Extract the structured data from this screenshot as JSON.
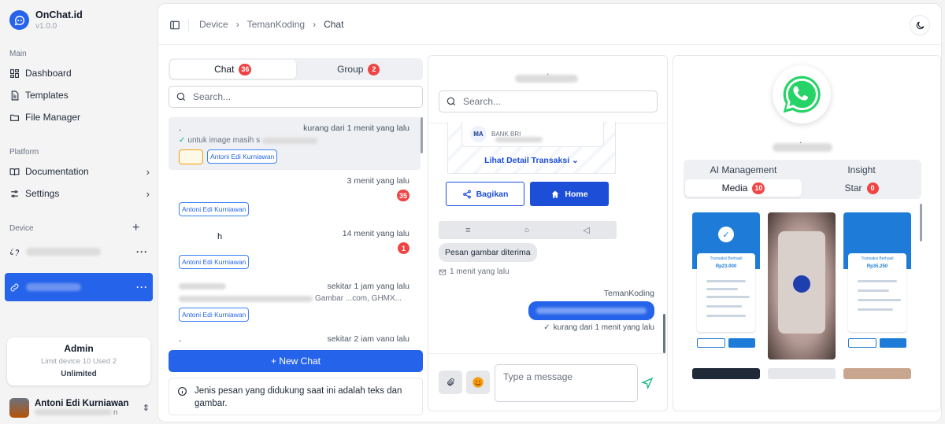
{
  "app": {
    "name": "OnChat.id",
    "version": "v1.0.0"
  },
  "sidebar": {
    "section_main": "Main",
    "main_items": [
      {
        "label": "Dashboard",
        "icon": "dashboard-icon"
      },
      {
        "label": "Templates",
        "icon": "file-text-icon"
      },
      {
        "label": "File Manager",
        "icon": "folder-icon"
      }
    ],
    "section_platform": "Platform",
    "platform_items": [
      {
        "label": "Documentation",
        "icon": "book-icon"
      },
      {
        "label": "Settings",
        "icon": "sliders-icon"
      }
    ],
    "section_device": "Device",
    "admin_card": {
      "title": "Admin",
      "limit": "Limit device 10 Used 2",
      "plan": "Unlimited"
    },
    "user": {
      "name": "Antoni Edi Kurniawan",
      "suffix": "n"
    }
  },
  "topbar": {
    "breadcrumb": [
      "Device",
      "TemanKoding",
      "Chat"
    ]
  },
  "chat_panel": {
    "tabs": [
      {
        "label": "Chat",
        "count": "36"
      },
      {
        "label": "Group",
        "count": "2"
      }
    ],
    "search_placeholder": "Search...",
    "items": [
      {
        "name": ".",
        "time": "kurang dari 1 menit yang lalu",
        "preview": "untuk image masih s",
        "tag": "Antoni Edi Kurniawan",
        "badge": ""
      },
      {
        "name": "",
        "time": "3 menit yang lalu",
        "preview": "",
        "tag": "Antoni Edi Kurniawan",
        "badge": "35"
      },
      {
        "name": "h",
        "time": "14 menit yang lalu",
        "preview": "",
        "tag": "Antoni Edi Kurniawan",
        "badge": "1"
      },
      {
        "name": "",
        "time": "sekitar 1 jam yang lalu",
        "preview": "Gambar ...com, GHMX...",
        "tag": "Antoni Edi Kurniawan",
        "badge": ""
      },
      {
        "name": ".",
        "time": "sekitar 2 jam yang lalu",
        "preview": "",
        "tag": "",
        "badge": ""
      }
    ],
    "new_chat_label": "+ New Chat",
    "info_text": "Jenis pesan yang didukung saat ini adalah teks dan gambar."
  },
  "conversation": {
    "contact_name": ".",
    "search_placeholder": "Search...",
    "receipt": {
      "bank_initials": "MA",
      "bank_name": "BANK BRI",
      "detail_link": "Lihat Detail Transaksi ⌄"
    },
    "buttons": {
      "share": "Bagikan",
      "home": "Home"
    },
    "android_nav": [
      "≡",
      "○",
      "◁"
    ],
    "incoming": {
      "text": "Pesan gambar diterima",
      "time": "1 menit yang lalu"
    },
    "outgoing": {
      "sender": "TemanKoding",
      "time": "kurang dari 1 menit yang lalu"
    },
    "composer_placeholder": "Type a message"
  },
  "media_panel": {
    "contact_name": ".",
    "tabs_top": [
      "AI Management",
      "Insight"
    ],
    "tabs_bottom": [
      {
        "label": "Media",
        "count": "10"
      },
      {
        "label": "Star",
        "count": "0"
      }
    ],
    "thumb_captions": [
      "Transaksi Berhasil",
      "Rp23.000",
      "Rp35.250"
    ]
  },
  "colors": {
    "primary": "#2563eb",
    "badge": "#ef4444",
    "whatsapp": "#25d366"
  }
}
